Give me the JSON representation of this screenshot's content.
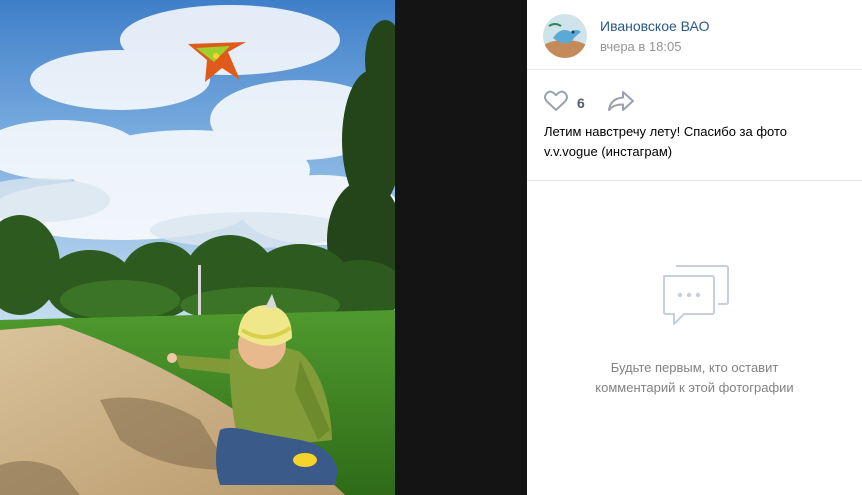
{
  "author": {
    "name": "Ивановское ВАО",
    "time": "вчера в 18:05"
  },
  "actions": {
    "like_count": "6",
    "like_icon": "heart-outline-icon",
    "share_icon": "share-arrow-icon"
  },
  "post": {
    "caption": "Летим навстречу лету! Спасибо за фото v.v.vogue (инстаграм)"
  },
  "comments": {
    "empty_icon": "chat-bubble-icon",
    "empty_text": "Будьте первым, кто оставит комментарий к этой фотографии"
  },
  "colors": {
    "link": "#2a5885",
    "muted": "#939393",
    "icon": "#99a2ad",
    "viewer_bg": "#141414"
  }
}
